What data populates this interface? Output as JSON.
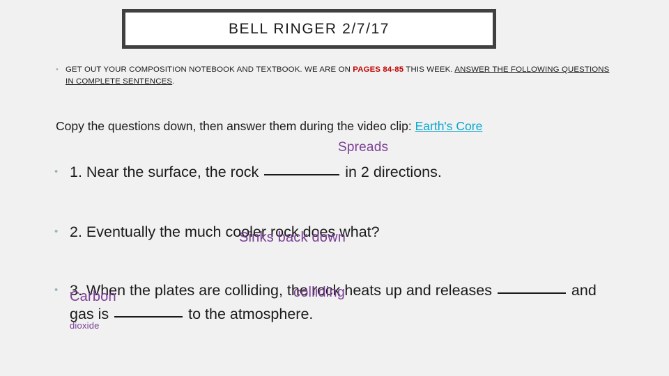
{
  "slide": {
    "title": "BELL RINGER 2/7/17",
    "background_color": "#f1f1f1",
    "title_box_border_color": "#404040",
    "accent_red": "#c00000",
    "link_cyan": "#09a7cd",
    "ink_purple": "#7b3f96"
  },
  "intro": {
    "bullet_glyph": "•",
    "part1": "GET OUT YOUR COMPOSITION NOTEBOOK AND TEXTBOOK. WE ARE ON ",
    "pages_emphasis": "PAGES 84-85",
    "part2": " THIS WEEK. ",
    "underlined_sentence": "ANSWER THE FOLLOWING QUESTIONS IN COMPLETE SENTENCES",
    "part3": "."
  },
  "copy_paragraph": {
    "text": "Copy the questions down, then answer them during the video clip: ",
    "link_label": "Earth's Core"
  },
  "questions": [
    {
      "bullet_glyph": "•",
      "number": "1.",
      "before": " Near the surface, the rock ",
      "after": " in 2 directions."
    },
    {
      "bullet_glyph": "•",
      "number": "2.",
      "text": " Eventually the much cooler rock does what?"
    },
    {
      "bullet_glyph": "•",
      "number": "3.",
      "seg1": " When the plates are colliding, the rock heats up and releases ",
      "seg2": " and gas is ",
      "seg3": " to the atmosphere."
    }
  ],
  "annotations": [
    {
      "id": "spreads",
      "text": "Spreads"
    },
    {
      "id": "sinks",
      "text": "Sinks back down"
    },
    {
      "id": "colliding",
      "text": "colliding"
    },
    {
      "id": "carbon_line1",
      "text": "Carbon"
    },
    {
      "id": "carbon_line2",
      "text": "dioxide"
    }
  ]
}
